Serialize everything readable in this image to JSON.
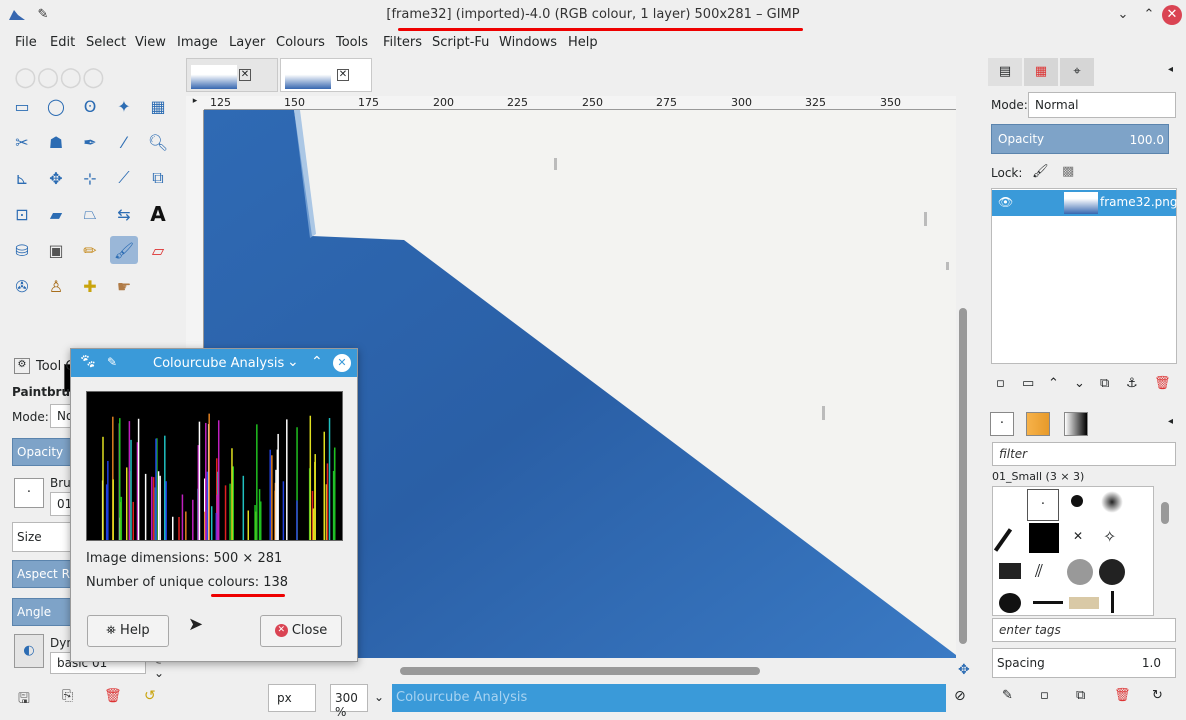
{
  "window": {
    "title": "[frame32] (imported)-4.0 (RGB colour, 1 layer) 500x281 – GIMP"
  },
  "menu": [
    "File",
    "Edit",
    "Select",
    "View",
    "Image",
    "Layer",
    "Colours",
    "Tools",
    "Filters",
    "Script-Fu",
    "Windows",
    "Help"
  ],
  "ruler": {
    "ticks": [
      "125",
      "150",
      "175",
      "200",
      "225",
      "250",
      "275",
      "300",
      "325",
      "350"
    ]
  },
  "tool_options": {
    "tab_label": "Tool O",
    "tool_name": "Paintbrush",
    "mode_label": "Mode:",
    "mode_value": "No",
    "opacity_label": "Opacity",
    "brush_label": "Bru",
    "brush_value": "01",
    "size_label": "Size",
    "aspect_label": "Aspect R...",
    "angle_label": "Angle",
    "dynamics_label": "Dyn",
    "dynamics_value": "basic 01"
  },
  "dialog": {
    "title": "Colourcube Analysis",
    "dimensions": "Image dimensions: 500 × 281",
    "unique_colours": "Number of unique colours: 138",
    "help_label": "Help",
    "close_label": "Close"
  },
  "statusbar": {
    "unit": "px",
    "zoom": "300 %",
    "message": "Colourcube Analysis"
  },
  "layers": {
    "mode_label": "Mode:",
    "mode_value": "Normal",
    "opacity_label": "Opacity",
    "opacity_value": "100.0",
    "lock_label": "Lock:",
    "layer_name": "frame32.png"
  },
  "brushes": {
    "filter_placeholder": "filter",
    "current_brush": "01_Small (3 × 3)",
    "tags_placeholder": "enter tags",
    "spacing_label": "Spacing",
    "spacing_value": "1.0"
  },
  "colors": {
    "accent": "#3a9ad9",
    "canvas_blue": "#3767b0",
    "red_annotation": "#e00000"
  }
}
